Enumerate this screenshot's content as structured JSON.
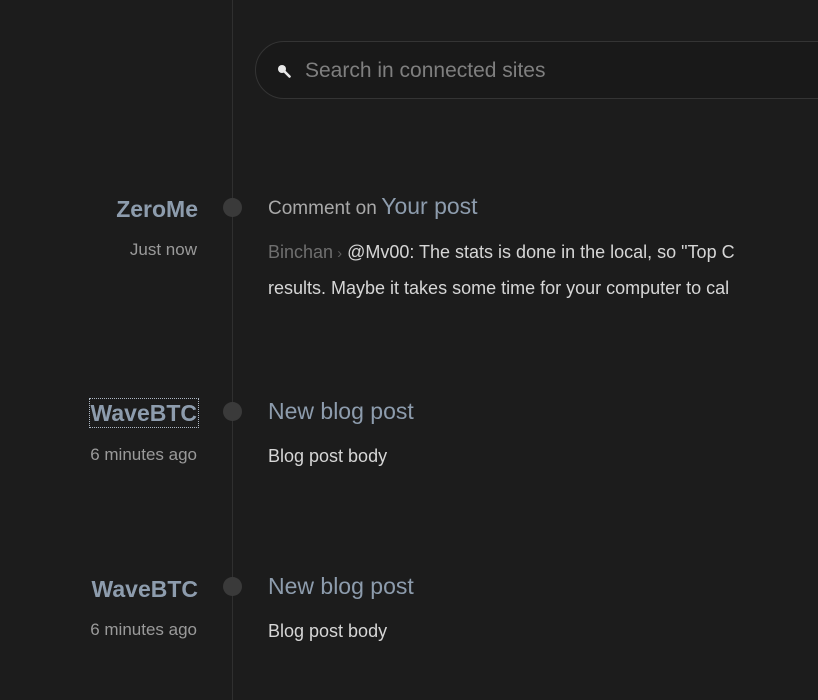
{
  "search": {
    "placeholder": "Search in connected sites"
  },
  "feed": [
    {
      "site": "ZeroMe",
      "time": "Just now",
      "title_prefix": "Comment on",
      "title_link": "Your post",
      "author": "Binchan",
      "separator": "›",
      "body_line1": "@Mv00: The stats is done in the local, so \"Top C",
      "body_line2": "results. Maybe it takes some time for your computer to cal"
    },
    {
      "site": "WaveBTC",
      "time": "6 minutes ago",
      "title_link": "New blog post",
      "body": "Blog post body"
    },
    {
      "site": "WaveBTC",
      "time": "6 minutes ago",
      "title_link": "New blog post",
      "body": "Blog post body"
    }
  ],
  "colors": {
    "background": "#1c1c1c",
    "link": "#8d9cad",
    "timeline": "#2f2f2f",
    "dot": "#3a3a3a",
    "body_text": "#d6d6d6",
    "muted_text": "#9a9a9a"
  }
}
